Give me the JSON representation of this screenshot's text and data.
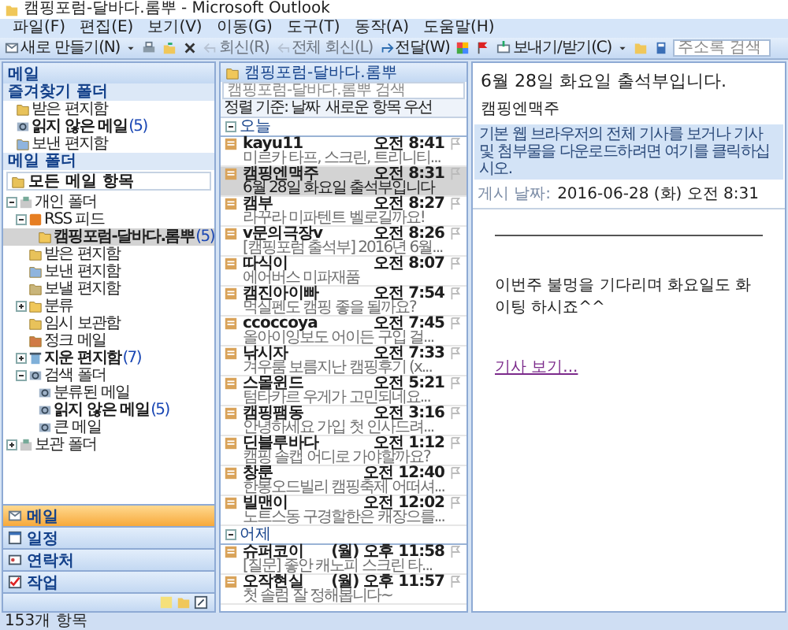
{
  "window": {
    "title": "캠핑포럼-달바다.롬뿌 - Microsoft Outlook"
  },
  "menu": [
    "파일(F)",
    "편집(E)",
    "보기(V)",
    "이동(G)",
    "도구(T)",
    "동작(A)",
    "도움말(H)"
  ],
  "toolbar": [
    {
      "kind": "new",
      "label": "새로 만들기(N)",
      "disabled": false
    },
    {
      "kind": "caret",
      "disabled": false
    },
    {
      "kind": "print",
      "disabled": false
    },
    {
      "kind": "move",
      "disabled": false
    },
    {
      "kind": "delete",
      "disabled": false
    },
    {
      "kind": "reply",
      "label": "회신(R)",
      "disabled": true
    },
    {
      "kind": "replyall",
      "label": "전체 회신(L)",
      "disabled": true
    },
    {
      "kind": "forward",
      "label": "전달(W)",
      "disabled": false
    },
    {
      "kind": "category",
      "disabled": false
    },
    {
      "kind": "flag",
      "disabled": false
    },
    {
      "kind": "sendreceive",
      "label": "보내기/받기(C)",
      "disabled": false
    },
    {
      "kind": "caret",
      "disabled": false
    },
    {
      "kind": "folder",
      "disabled": false
    },
    {
      "kind": "book",
      "disabled": false
    }
  ],
  "address_search": {
    "placeholder": "주소록 검색"
  },
  "nav": {
    "title": "메일",
    "favorites_title": "즐겨찾기 폴더",
    "favorites": [
      {
        "label": "받은 편지함",
        "kind": "inbox"
      },
      {
        "label": "읽지 않은 메일",
        "count": "(5)",
        "kind": "search"
      },
      {
        "label": "보낸 편지함",
        "kind": "sent"
      }
    ],
    "folders_title": "메일 폴더",
    "view": "모든 메일 항목",
    "tree": [
      {
        "label": "개인 폴더",
        "kind": "personal",
        "expanded": true,
        "selected": false,
        "children": [
          {
            "label": "RSS 피드",
            "kind": "rss",
            "expanded": true,
            "selected": false,
            "children": [
              {
                "label": "캠핑포럼-달바다.롬뿌",
                "count": "(5)",
                "kind": "folder",
                "selected": true
              }
            ]
          },
          {
            "label": "받은 편지함",
            "kind": "inbox",
            "selected": false
          },
          {
            "label": "보낸 편지함",
            "kind": "sent",
            "selected": false
          },
          {
            "label": "보낼 편지함",
            "kind": "outbox",
            "selected": false
          },
          {
            "label": "분류",
            "kind": "folder",
            "expanded": false,
            "selected": false
          },
          {
            "label": "임시 보관함",
            "kind": "drafts",
            "selected": false
          },
          {
            "label": "정크 메일",
            "kind": "junk",
            "selected": false
          },
          {
            "label": "지운 편지함",
            "count": "(7)",
            "kind": "trash",
            "expanded": false,
            "selected": false
          },
          {
            "label": "검색 폴더",
            "kind": "search",
            "expanded": true,
            "selected": false,
            "children": [
              {
                "label": "분류된 메일",
                "kind": "search",
                "selected": false
              },
              {
                "label": "읽지 않은 메일",
                "count": "(5)",
                "kind": "search",
                "selected": false
              },
              {
                "label": "큰 메일",
                "kind": "search",
                "selected": false
              }
            ]
          }
        ]
      },
      {
        "label": "보관 폴더",
        "kind": "personal",
        "expanded": false,
        "selected": false
      }
    ],
    "sections": [
      {
        "label": "메일",
        "kind": "mail",
        "selected": true
      },
      {
        "label": "일정",
        "kind": "calendar",
        "selected": false
      },
      {
        "label": "연락처",
        "kind": "contacts",
        "selected": false
      },
      {
        "label": "작업",
        "kind": "tasks",
        "selected": false
      }
    ]
  },
  "list": {
    "title": "캠핑포럼-달바다.롬뿌",
    "search_placeholder": "캠핑포럼-달바다.롬뿌 검색",
    "arrange": "정렬 기준: 날짜",
    "order": "새로운 항목 우선",
    "groups": [
      {
        "label": "오늘",
        "expanded": true,
        "items": [
          {
            "sender": "kayu11",
            "time": "오전 8:41",
            "preview": "미르카 타프, 스크린, 트리니티...",
            "selected": false
          },
          {
            "sender": "캠핑엔맥주",
            "time": "오전 8:31",
            "preview": "6월 28일 화요일 출석부입니다",
            "selected": true
          },
          {
            "sender": "캠부",
            "time": "오전 8:27",
            "preview": "라꾸라 미파텐트 벨로길까요!",
            "selected": false
          },
          {
            "sender": "v문의극장v",
            "time": "오전 8:26",
            "preview": "[캠핑포럼 출석부] 2016년 6월...",
            "selected": false
          },
          {
            "sender": "따식이",
            "time": "오전 8:07",
            "preview": "에어버스 미파재품",
            "selected": false
          },
          {
            "sender": "캠진아이빠",
            "time": "오전 7:54",
            "preview": "먹실펜도 캠핑 좋을 될까요?",
            "selected": false
          },
          {
            "sender": "ccoccoya",
            "time": "오전 7:45",
            "preview": "올아이잉보도 어이든 구입 걸...",
            "selected": false
          },
          {
            "sender": "낚시자",
            "time": "오전 7:33",
            "preview": "겨우룸 보름지난 캠핑후기 (x...",
            "selected": false
          },
          {
            "sender": "스몰윈드",
            "time": "오전 5:21",
            "preview": "텀타카르 우게가 고민되네요...",
            "selected": false
          },
          {
            "sender": "캠핑팸동",
            "time": "오전 3:16",
            "preview": "안녕하세요 가입 첫 인사드려...",
            "selected": false
          },
          {
            "sender": "딘블루바다",
            "time": "오전 1:12",
            "preview": "캠핑 솔캡 어디로 가야할까요?",
            "selected": false
          },
          {
            "sender": "창룬",
            "time": "오전 12:40",
            "preview": "한봉오드빌리 캠핑축제 어떠셔...",
            "selected": false
          },
          {
            "sender": "빌맨이",
            "time": "오전 12:02",
            "preview": "노트스동 구경할한은 캐장으를...",
            "selected": false
          }
        ]
      },
      {
        "label": "어제",
        "expanded": true,
        "items": [
          {
            "sender": "슈퍼코이",
            "time": "(월) 오후 11:58",
            "preview": "[질문] 좋안 캐노피 스크린 타...",
            "selected": false
          },
          {
            "sender": "오작현실",
            "time": "(월) 오후 11:57",
            "preview": "첫 솔럼 잘 정해봅니다~",
            "selected": false
          }
        ]
      }
    ]
  },
  "reading": {
    "subject": "6월 28일 화요일 출석부입니다.",
    "sender": "캠핑엔맥주",
    "info_bar": "기본 웹 브라우저의 전체 기사를 보거나 기사 및 첨부물을 다운로드하려면 여기를 클릭하십시오.",
    "date_label": "게시 날짜:",
    "date": "2016-06-28 (화) 오전 8:31",
    "body": "이번주 불멍을 기다리며 화요일도 화이팅 하시죠^^",
    "link": "기사 보기..."
  },
  "status_bar": "153개 항목"
}
